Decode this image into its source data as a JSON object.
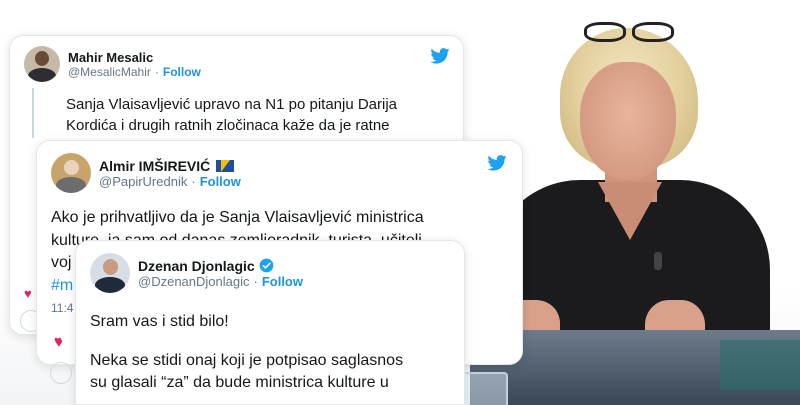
{
  "colors": {
    "twitter_blue": "#1da1f2",
    "follow_blue": "#1b95e0",
    "verified_blue": "#1da1f2",
    "heart_red": "#e0245e",
    "handle_gray": "#657786"
  },
  "tweets": [
    {
      "author": "Mahir Mesalic",
      "handle": "@MesalicMahir",
      "follow_label": "Follow",
      "text_lines": [
        "Sanja Vlaisavljević upravo na N1 po pitanju Darija",
        "Kordića i drugih ratnih zločinaca kaže da je ratne"
      ],
      "icon": "twitter-bird-icon"
    },
    {
      "author": "Almir IMŠIREVIĆ",
      "handle": "@PapirUrednik",
      "follow_label": "Follow",
      "flag_icon": "bosnia-flag-icon",
      "text_lines": [
        "Ako je prihvatljivo da je Sanja Vlaisavljević ministrica",
        "kulture, ja sam od danas zemljoradnik, turista, učitelj",
        "voj",
        "#m",
        "11:4"
      ],
      "icon": "twitter-bird-icon"
    },
    {
      "author": "Dzenan Djonlagic",
      "handle": "@DzenanDjonlagic",
      "follow_label": "Follow",
      "verified_icon": "verified-badge-icon",
      "text_lines": [
        "Sram vas i stid bilo!",
        "Neka se stidi onaj koji je potpisao saglasnos",
        "su glasali “za” da bude ministrica kulture u"
      ],
      "icon": "twitter-bird-icon"
    }
  ]
}
